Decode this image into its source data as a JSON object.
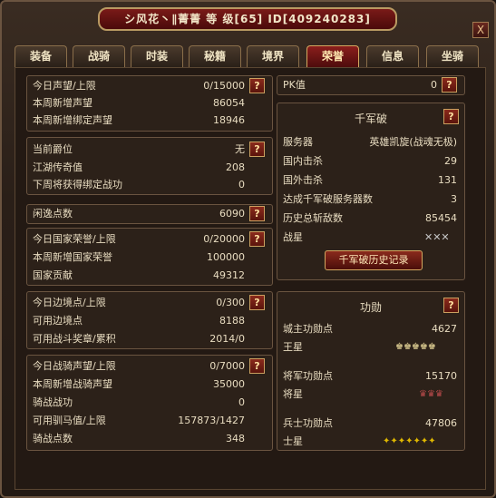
{
  "title": "シ风花丶∥菁菁 等 级[65] ID[409240283]",
  "close_label": "X",
  "tabs": [
    "装备",
    "战骑",
    "时装",
    "秘籍",
    "境界",
    "荣誉",
    "信息",
    "坐骑"
  ],
  "help_label": "?",
  "left": {
    "p1": [
      {
        "label": "今日声望/上限",
        "value": "0/15000"
      },
      {
        "label": "本周新增声望",
        "value": "86054"
      },
      {
        "label": "本周新增绑定声望",
        "value": "18946"
      }
    ],
    "p2": [
      {
        "label": "当前爵位",
        "value": "无"
      },
      {
        "label": "江湖传奇值",
        "value": "208"
      },
      {
        "label": "下周将获得绑定战功",
        "value": "0"
      }
    ],
    "p3": [
      {
        "label": "闲逸点数",
        "value": "6090"
      }
    ],
    "p4": [
      {
        "label": "今日国家荣誉/上限",
        "value": "0/20000"
      },
      {
        "label": "本周新增国家荣誉",
        "value": "100000"
      },
      {
        "label": "国家贡献",
        "value": "49312"
      }
    ],
    "p5": [
      {
        "label": "今日边境点/上限",
        "value": "0/300"
      },
      {
        "label": "可用边境点",
        "value": "8188"
      },
      {
        "label": "可用战斗奖章/累积",
        "value": "2014/0"
      }
    ],
    "p6": [
      {
        "label": "今日战骑声望/上限",
        "value": "0/7000"
      },
      {
        "label": "本周新增战骑声望",
        "value": "35000"
      },
      {
        "label": "骑战战功",
        "value": "0"
      },
      {
        "label": "可用驯马值/上限",
        "value": "157873/1427"
      },
      {
        "label": "骑战点数",
        "value": "348"
      }
    ]
  },
  "pk": {
    "label": "PK值",
    "value": "0"
  },
  "qjp": {
    "title": "千军破",
    "rows": [
      {
        "label": "服务器",
        "value": "英雄凯旋(战魂无极)"
      },
      {
        "label": "国内击杀",
        "value": "29"
      },
      {
        "label": "国外击杀",
        "value": "131"
      },
      {
        "label": "达成千军破服务器数",
        "value": "3"
      },
      {
        "label": "历史总斩敌数",
        "value": "85454"
      }
    ],
    "star_label": "战星",
    "star_icons": "✕✕✕",
    "history_button": "千军破历史记录"
  },
  "merit": {
    "title": "功勋",
    "city_label": "城主功勋点",
    "city_value": "4627",
    "king_label": "王星",
    "king_icons": "♚♚♚♚♚",
    "general_label": "将军功勋点",
    "general_value": "15170",
    "general_star_label": "将星",
    "general_icons": "♛♛♛",
    "soldier_label": "兵士功勋点",
    "soldier_value": "47806",
    "soldier_star_label": "士星",
    "soldier_icons": "✦✦✦✦✦✦✦"
  }
}
